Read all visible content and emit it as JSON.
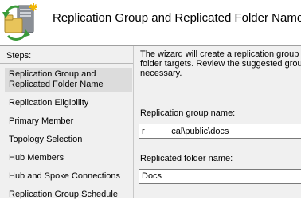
{
  "header": {
    "title": "Replication Group and Replicated Folder Name",
    "icon": "replication-folders-icon"
  },
  "steps": {
    "heading": "Steps:",
    "items": [
      {
        "label": "Replication Group and Replicated Folder Name",
        "active": true
      },
      {
        "label": "Replication Eligibility"
      },
      {
        "label": "Primary Member"
      },
      {
        "label": "Topology Selection"
      },
      {
        "label": "Hub Members"
      },
      {
        "label": "Hub and Spoke Connections"
      },
      {
        "label": "Replication Group Schedule"
      }
    ]
  },
  "content": {
    "description_lines": [
      "The wizard will create a replication group th",
      "folder targets. Review the suggested group",
      "necessary."
    ],
    "group_name_label": "Replication group name:",
    "group_name_value": "r           cal\\public\\docs",
    "folder_name_label": "Replicated folder name:",
    "folder_name_value": "Docs"
  },
  "colors": {
    "pane_background": "#f0f0f0",
    "active_step": "#dcdcdc"
  }
}
